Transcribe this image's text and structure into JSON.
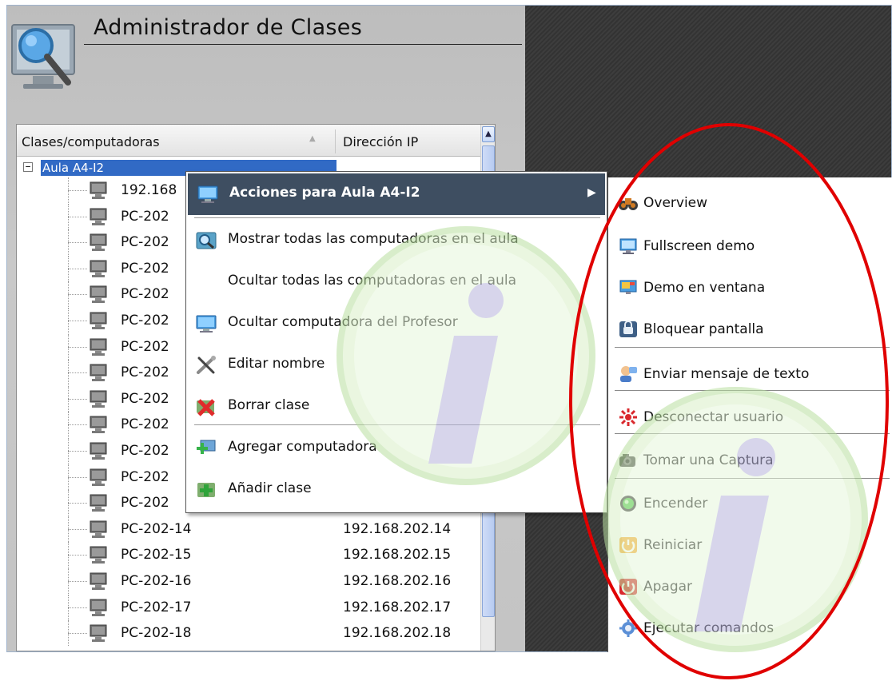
{
  "app": {
    "title": "Administrador de Clases"
  },
  "tree": {
    "columns": {
      "name": "Clases/computadoras",
      "ip": "Dirección IP"
    },
    "group": {
      "expander": "−",
      "label": "Aula A4-I2"
    },
    "rows": [
      {
        "name": "192.168",
        "ip": ""
      },
      {
        "name": "PC-202",
        "ip": ""
      },
      {
        "name": "PC-202",
        "ip": ""
      },
      {
        "name": "PC-202",
        "ip": ""
      },
      {
        "name": "PC-202",
        "ip": ""
      },
      {
        "name": "PC-202",
        "ip": ""
      },
      {
        "name": "PC-202",
        "ip": ""
      },
      {
        "name": "PC-202",
        "ip": ""
      },
      {
        "name": "PC-202",
        "ip": ""
      },
      {
        "name": "PC-202",
        "ip": ""
      },
      {
        "name": "PC-202",
        "ip": ""
      },
      {
        "name": "PC-202",
        "ip": ""
      },
      {
        "name": "PC-202",
        "ip": ""
      },
      {
        "name": "PC-202-14",
        "ip": "192.168.202.14"
      },
      {
        "name": "PC-202-15",
        "ip": "192.168.202.15"
      },
      {
        "name": "PC-202-16",
        "ip": "192.168.202.16"
      },
      {
        "name": "PC-202-17",
        "ip": "192.168.202.17"
      },
      {
        "name": "PC-202-18",
        "ip": "192.168.202.18"
      }
    ]
  },
  "context_menu": {
    "header": "Acciones para Aula A4-I2",
    "items": [
      {
        "label": "Mostrar todas las computadoras en el aula",
        "icon": "search-classroom-icon"
      },
      {
        "label": "Ocultar todas las computadoras en el aula",
        "icon": ""
      },
      {
        "label": "Ocultar computadora del Profesor",
        "icon": "monitor-icon"
      },
      {
        "label": "Editar nombre",
        "icon": "tools-icon"
      },
      {
        "label": "Borrar clase",
        "icon": "delete-icon"
      },
      {
        "label": "Agregar computadora",
        "icon": "add-computer-icon"
      },
      {
        "label": "Añadir clase",
        "icon": "add-class-icon"
      }
    ]
  },
  "submenu": {
    "items": [
      {
        "label": "Overview",
        "icon": "binoculars-icon"
      },
      {
        "label": "Fullscreen demo",
        "icon": "fullscreen-demo-icon"
      },
      {
        "label": "Demo en ventana",
        "icon": "window-demo-icon"
      },
      {
        "label": "Bloquear pantalla",
        "icon": "lock-screen-icon"
      },
      {
        "label": "Enviar mensaje de texto",
        "icon": "message-icon"
      },
      {
        "label": "Desconectar usuario",
        "icon": "disconnect-icon"
      },
      {
        "label": "Tomar una Captura",
        "icon": "camera-icon"
      },
      {
        "label": "Encender",
        "icon": "power-on-icon"
      },
      {
        "label": "Reiniciar",
        "icon": "restart-icon"
      },
      {
        "label": "Apagar",
        "icon": "shutdown-icon"
      },
      {
        "label": "Ejecutar comandos",
        "icon": "gear-icon"
      }
    ]
  },
  "colors": {
    "selection": "#316ac5",
    "menu_header": "#3e4e61",
    "annotation": "#e00000"
  }
}
